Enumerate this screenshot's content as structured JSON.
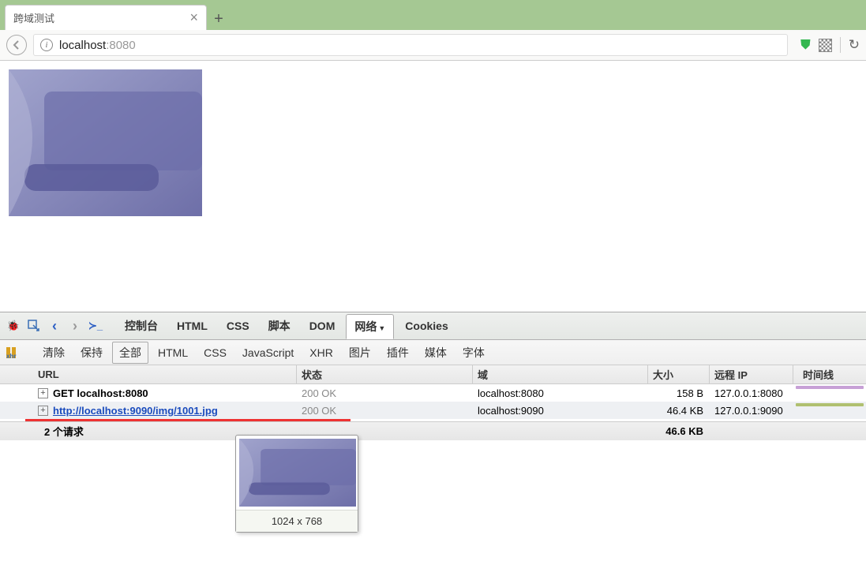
{
  "browser": {
    "tab_title": "跨域测试",
    "url_host": "localhost",
    "url_port": ":8080"
  },
  "devtools": {
    "tabs": {
      "console": "控制台",
      "html": "HTML",
      "css": "CSS",
      "script": "脚本",
      "dom": "DOM",
      "network": "网络",
      "cookies": "Cookies"
    },
    "filters": {
      "clear": "清除",
      "persist": "保持",
      "all": "全部",
      "html": "HTML",
      "css": "CSS",
      "js": "JavaScript",
      "xhr": "XHR",
      "images": "图片",
      "plugins": "插件",
      "media": "媒体",
      "fonts": "字体"
    },
    "headers": {
      "url": "URL",
      "status": "状态",
      "domain": "域",
      "size": "大小",
      "remote": "远程 IP",
      "timeline": "时间线"
    },
    "rows": [
      {
        "url": "GET localhost:8080",
        "status": "200 OK",
        "domain": "localhost:8080",
        "size": "158 B",
        "remote": "127.0.0.1:8080",
        "link": false
      },
      {
        "url": "http://localhost:9090/img/1001.jpg",
        "status": "200 OK",
        "domain": "localhost:9090",
        "size": "46.4 KB",
        "remote": "127.0.0.1:9090",
        "link": true
      }
    ],
    "summary": {
      "count": "2 个请求",
      "total": "46.6 KB"
    },
    "preview_dim": "1024 x 768"
  }
}
